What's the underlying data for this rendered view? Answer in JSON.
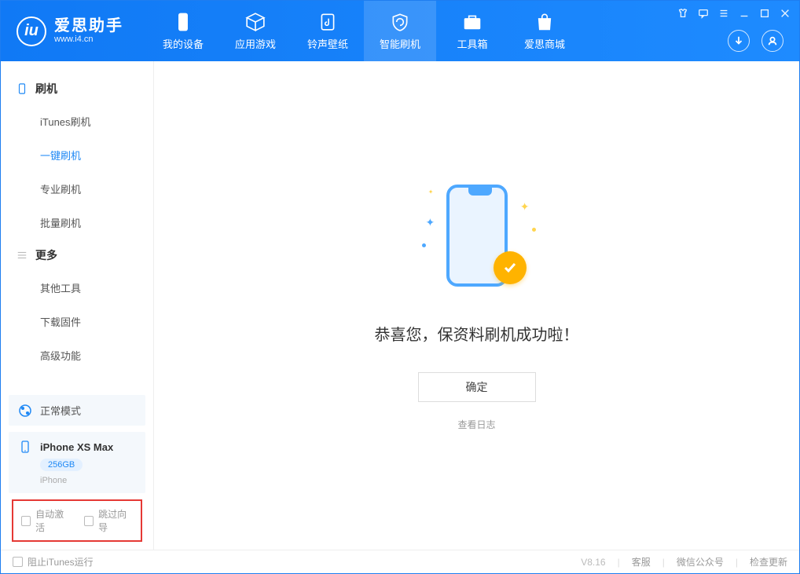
{
  "logo": {
    "title": "爱思助手",
    "subtitle": "www.i4.cn",
    "glyph": "iu"
  },
  "tabs": [
    {
      "label": "我的设备"
    },
    {
      "label": "应用游戏"
    },
    {
      "label": "铃声壁纸"
    },
    {
      "label": "智能刷机"
    },
    {
      "label": "工具箱"
    },
    {
      "label": "爱思商城"
    }
  ],
  "sidebar": {
    "group1": {
      "title": "刷机",
      "items": [
        "iTunes刷机",
        "一键刷机",
        "专业刷机",
        "批量刷机"
      ]
    },
    "group2": {
      "title": "更多",
      "items": [
        "其他工具",
        "下载固件",
        "高级功能"
      ]
    },
    "mode": "正常模式",
    "device": {
      "name": "iPhone XS Max",
      "capacity": "256GB",
      "type": "iPhone"
    },
    "checkbox1": "自动激活",
    "checkbox2": "跳过向导"
  },
  "main": {
    "success_title": "恭喜您，保资料刷机成功啦！",
    "ok_button": "确定",
    "log_link": "查看日志"
  },
  "footer": {
    "block_itunes": "阻止iTunes运行",
    "version": "V8.16",
    "link1": "客服",
    "link2": "微信公众号",
    "link3": "检查更新"
  }
}
